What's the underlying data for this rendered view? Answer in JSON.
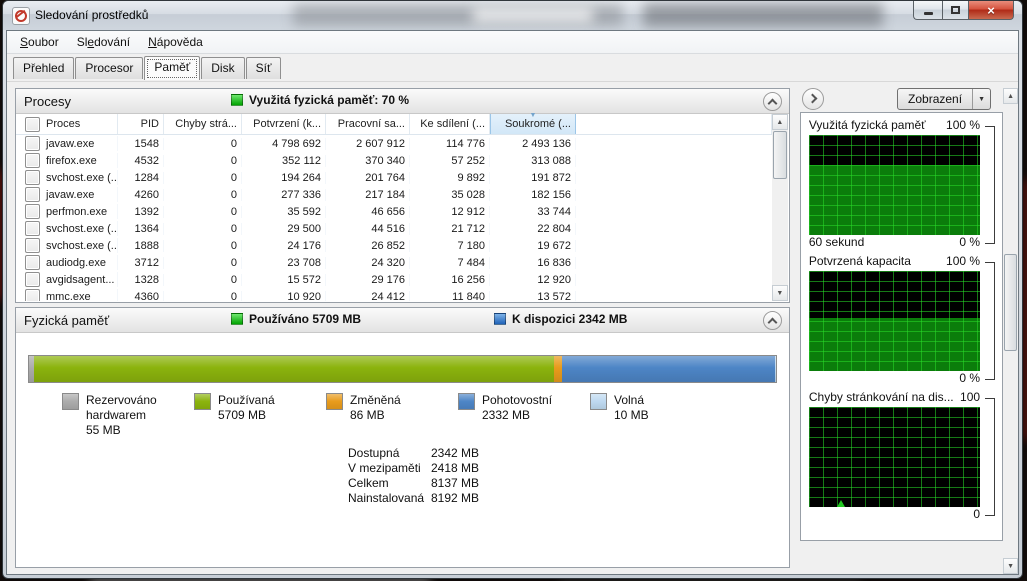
{
  "window": {
    "title": "Sledování prostředků"
  },
  "menu": {
    "items": [
      {
        "label": "Soubor",
        "underline_index": 0
      },
      {
        "label": "Sledování",
        "underline_index": 2
      },
      {
        "label": "Nápověda",
        "underline_index": 0
      }
    ]
  },
  "tabs": {
    "items": [
      {
        "label": "Přehled",
        "active": false
      },
      {
        "label": "Procesor",
        "active": false
      },
      {
        "label": "Paměť",
        "active": true
      },
      {
        "label": "Disk",
        "active": false
      },
      {
        "label": "Síť",
        "active": false
      }
    ]
  },
  "processes": {
    "title": "Procesy",
    "status_label": "Využitá fyzická paměť: 70 %",
    "columns": [
      "Proces",
      "PID",
      "Chyby strá...",
      "Potvrzení (k...",
      "Pracovní sa...",
      "Ke sdílení (...",
      "Soukromé (..."
    ],
    "sort_column_index": 6,
    "rows": [
      [
        "javaw.exe",
        "1548",
        "0",
        "4 798 692",
        "2 607 912",
        "114 776",
        "2 493 136"
      ],
      [
        "firefox.exe",
        "4532",
        "0",
        "352 112",
        "370 340",
        "57 252",
        "313 088"
      ],
      [
        "svchost.exe (...",
        "1284",
        "0",
        "194 264",
        "201 764",
        "9 892",
        "191 872"
      ],
      [
        "javaw.exe",
        "4260",
        "0",
        "277 336",
        "217 184",
        "35 028",
        "182 156"
      ],
      [
        "perfmon.exe",
        "1392",
        "0",
        "35 592",
        "46 656",
        "12 912",
        "33 744"
      ],
      [
        "svchost.exe (...",
        "1364",
        "0",
        "29 500",
        "44 516",
        "21 712",
        "22 804"
      ],
      [
        "svchost.exe (...",
        "1888",
        "0",
        "24 176",
        "26 852",
        "7 180",
        "19 672"
      ],
      [
        "audiodg.exe",
        "3712",
        "0",
        "23 708",
        "24 320",
        "7 484",
        "16 836"
      ],
      [
        "avgidsagent...",
        "1328",
        "0",
        "15 572",
        "29 176",
        "16 256",
        "12 920"
      ],
      [
        "mmc.exe",
        "4360",
        "0",
        "10 920",
        "24 412",
        "11 840",
        "13 572"
      ]
    ]
  },
  "physical_memory": {
    "title": "Fyzická paměť",
    "used_label": "Používáno 5709 MB",
    "available_label": "K dispozici 2342 MB",
    "total_mb": 8192,
    "segments": [
      {
        "label": "Rezervováno hardwarem",
        "value": "55 MB",
        "mb": 55,
        "color": "#ababab"
      },
      {
        "label": "Používaná",
        "value": "5709 MB",
        "mb": 5709,
        "color": "#8bb30d"
      },
      {
        "label": "Změněná",
        "value": "86 MB",
        "mb": 86,
        "color": "#e89b1c"
      },
      {
        "label": "Pohotovostní",
        "value": "2332 MB",
        "mb": 2332,
        "color": "#4d85c6"
      },
      {
        "label": "Volná",
        "value": "10 MB",
        "mb": 10,
        "color": "#bed9f0"
      }
    ],
    "details": [
      {
        "label": "Dostupná",
        "value": "2342 MB"
      },
      {
        "label": "V mezipaměti",
        "value": "2418 MB"
      },
      {
        "label": "Celkem",
        "value": "8137 MB"
      },
      {
        "label": "Nainstalovaná",
        "value": "8192 MB"
      }
    ]
  },
  "right_panel": {
    "views_button_label": "Zobrazení",
    "charts": [
      {
        "title": "Využitá fyzická paměť",
        "top_label": "100 %",
        "bottom_left_label": "60 sekund",
        "bottom_right_label": "0 %",
        "fill_percent": 70,
        "spike": false
      },
      {
        "title": "Potvrzená kapacita",
        "top_label": "100 %",
        "bottom_left_label": "",
        "bottom_right_label": "0 %",
        "fill_percent": 53,
        "spike": false
      },
      {
        "title": "Chyby stránkování na dis...",
        "top_label": "100",
        "bottom_left_label": "",
        "bottom_right_label": "0",
        "fill_percent": 0,
        "spike": true
      }
    ]
  },
  "icons": {
    "dropdown_arrow": "▼",
    "sort_arrow": "▼",
    "scroll_up": "▲",
    "scroll_down": "▼",
    "close_glyph": "×"
  }
}
